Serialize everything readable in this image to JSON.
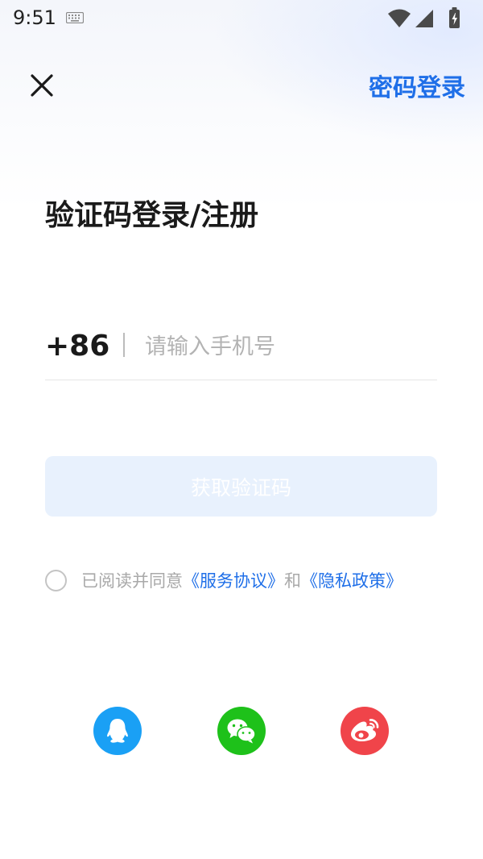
{
  "status_bar": {
    "time": "9:51",
    "icons": [
      "keyboard-icon",
      "wifi-icon",
      "signal-icon",
      "battery-icon"
    ]
  },
  "header": {
    "close_icon": "close-icon",
    "password_login_label": "密码登录"
  },
  "title": "验证码登录/注册",
  "phone": {
    "country_code": "+86",
    "placeholder": "请输入手机号",
    "value": ""
  },
  "get_code_button": "获取验证码",
  "agreement": {
    "checked": false,
    "prefix": "已阅读并同意",
    "service_link": "《服务协议》",
    "conjunction": "和",
    "privacy_link": "《隐私政策》"
  },
  "social_login": [
    {
      "name": "qq",
      "icon": "qq-icon",
      "color": "#1aa0f5"
    },
    {
      "name": "wechat",
      "icon": "wechat-icon",
      "color": "#1ec11a"
    },
    {
      "name": "weibo",
      "icon": "weibo-icon",
      "color": "#f0444a"
    }
  ],
  "colors": {
    "accent": "#1f6fe8",
    "button_disabled_bg": "#e8f1fd",
    "placeholder": "#b3b3b3"
  }
}
